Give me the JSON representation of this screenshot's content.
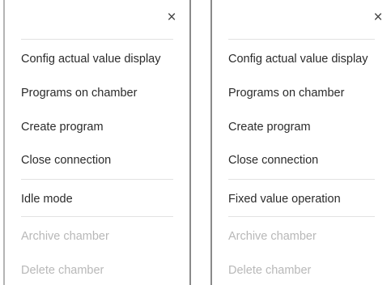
{
  "menus": [
    {
      "close_icon": "×",
      "items": [
        {
          "label": "Config actual value display",
          "enabled": true
        },
        {
          "label": "Programs on chamber",
          "enabled": true
        },
        {
          "label": "Create program",
          "enabled": true
        },
        {
          "label": "Close connection",
          "enabled": true
        },
        {
          "label": "Idle mode",
          "enabled": true
        },
        {
          "label": "Archive chamber",
          "enabled": false
        },
        {
          "label": "Delete chamber",
          "enabled": false
        }
      ]
    },
    {
      "close_icon": "×",
      "items": [
        {
          "label": "Config actual value display",
          "enabled": true
        },
        {
          "label": "Programs on chamber",
          "enabled": true
        },
        {
          "label": "Create program",
          "enabled": true
        },
        {
          "label": "Close connection",
          "enabled": true
        },
        {
          "label": "Fixed value operation",
          "enabled": true
        },
        {
          "label": "Archive chamber",
          "enabled": false
        },
        {
          "label": "Delete chamber",
          "enabled": false
        }
      ]
    }
  ],
  "colors": {
    "text": "#2b2b2b",
    "disabled_text": "#b8b8b8",
    "divider": "#e2e2e2"
  }
}
